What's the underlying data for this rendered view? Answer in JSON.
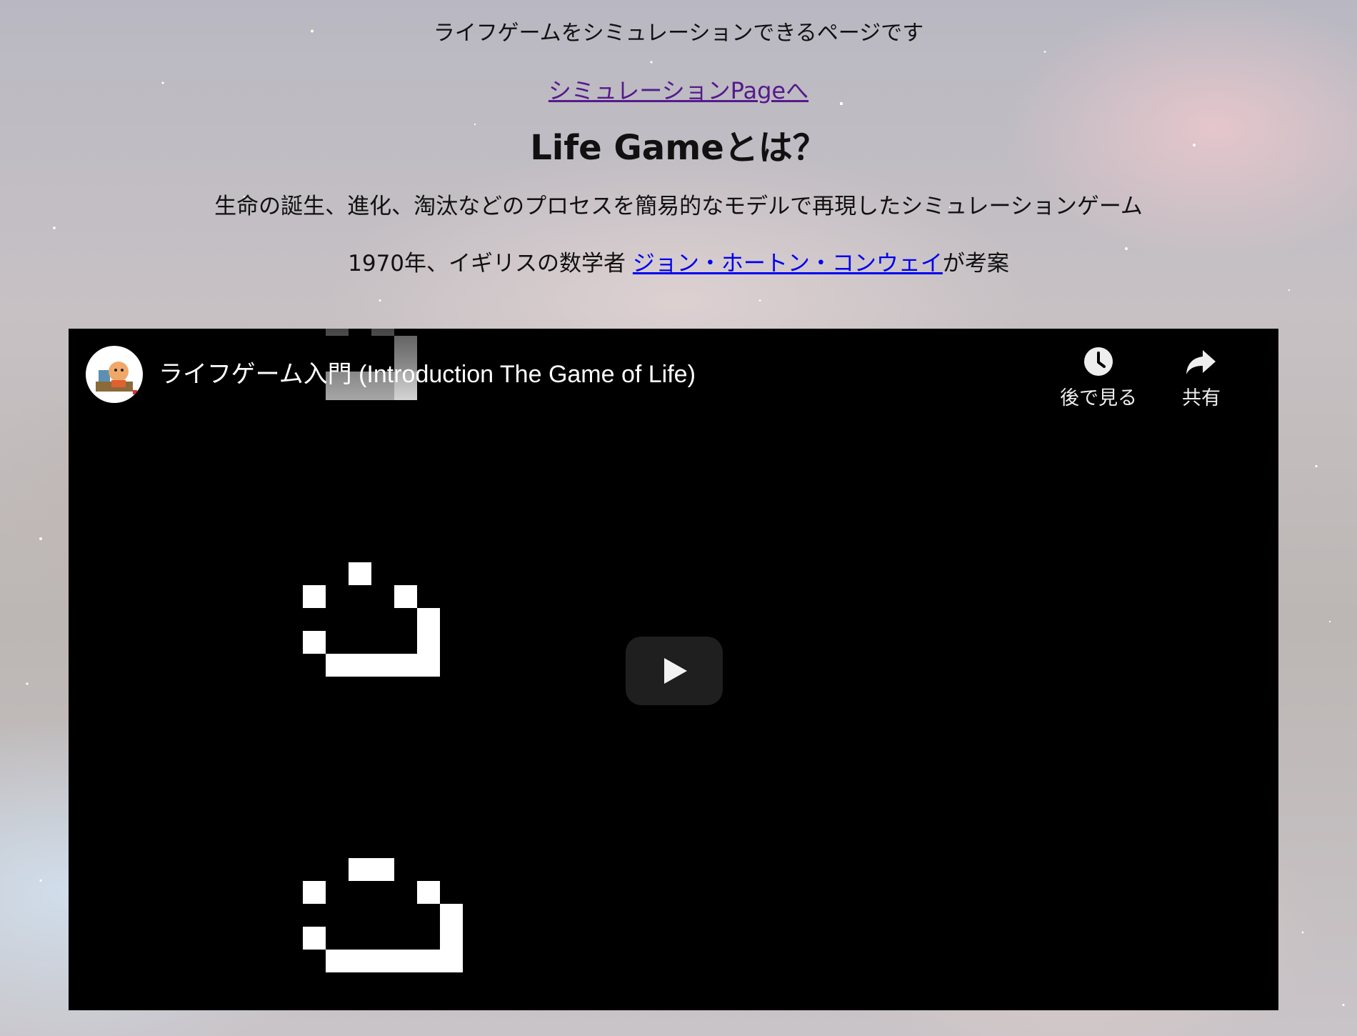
{
  "page": {
    "intro": "ライフゲームをシミュレーションできるページです",
    "simulation_link": "シミュレーションPageへ",
    "heading": "Life Gameとは？",
    "description": "生命の誕生、進化、淘汰などのプロセスを簡易的なモデルで再現したシミュレーションゲーム",
    "credit_prefix": "1970年、イギリスの数学者 ",
    "credit_link": "ジョン・ホートン・コンウェイ",
    "credit_suffix": "が考案"
  },
  "video": {
    "title": "ライフゲーム入門 (Introduction The Game of Life)",
    "watch_later_label": "後で見る",
    "share_label": "共有",
    "icons": {
      "watch_later": "clock-icon",
      "share": "share-arrow-icon",
      "play": "play-icon",
      "channel": "channel-avatar"
    }
  },
  "colors": {
    "visited_link": "#551a8b",
    "link": "#0000ee",
    "video_background": "#000000",
    "play_button": "#212121"
  }
}
